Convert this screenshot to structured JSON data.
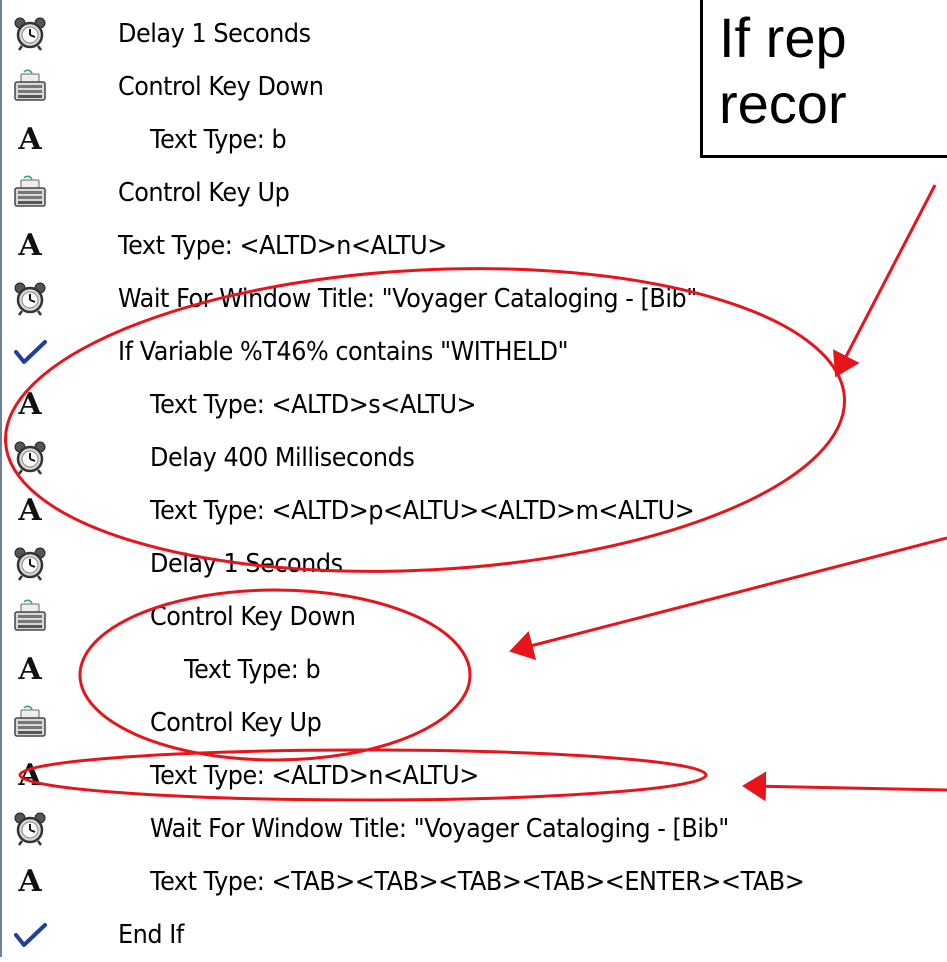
{
  "callout": {
    "text": "If rep\nrecor"
  },
  "rows": [
    {
      "icon": "alarm-clock-icon",
      "label": "Delay 1 Seconds",
      "indent": 0
    },
    {
      "icon": "keyboard-icon",
      "label": "Control Key Down",
      "indent": 0
    },
    {
      "icon": "text-a-icon",
      "label": "Text Type: b",
      "indent": 1
    },
    {
      "icon": "keyboard-icon",
      "label": "Control Key Up",
      "indent": 0
    },
    {
      "icon": "text-a-icon",
      "label": "Text Type: <ALTD>n<ALTU>",
      "indent": 0
    },
    {
      "icon": "alarm-clock-icon",
      "label": "Wait For Window Title: \"Voyager Cataloging - [Bib\"",
      "indent": 0
    },
    {
      "icon": "checkmark-icon",
      "label": "If Variable %T46% contains \"WITHELD\"",
      "indent": 0
    },
    {
      "icon": "text-a-icon",
      "label": "Text Type: <ALTD>s<ALTU>",
      "indent": 1
    },
    {
      "icon": "alarm-clock-icon",
      "label": "Delay 400 Milliseconds",
      "indent": 1
    },
    {
      "icon": "text-a-icon",
      "label": "Text Type: <ALTD>p<ALTU><ALTD>m<ALTU>",
      "indent": 1
    },
    {
      "icon": "alarm-clock-icon",
      "label": "Delay 1 Seconds",
      "indent": 1
    },
    {
      "icon": "keyboard-icon",
      "label": "Control Key Down",
      "indent": 1
    },
    {
      "icon": "text-a-icon",
      "label": "Text Type: b",
      "indent": 2
    },
    {
      "icon": "keyboard-icon",
      "label": "Control Key Up",
      "indent": 1
    },
    {
      "icon": "text-a-icon",
      "label": "Text Type: <ALTD>n<ALTU>",
      "indent": 1
    },
    {
      "icon": "alarm-clock-icon",
      "label": "Wait For Window Title: \"Voyager Cataloging - [Bib\"",
      "indent": 1
    },
    {
      "icon": "text-a-icon",
      "label": "Text Type: <TAB><TAB><TAB><TAB><ENTER><TAB>",
      "indent": 1
    },
    {
      "icon": "checkmark-icon",
      "label": "End If",
      "indent": 0
    }
  ],
  "colors": {
    "annotation": "#e8141c",
    "border": "#6f7f99"
  }
}
